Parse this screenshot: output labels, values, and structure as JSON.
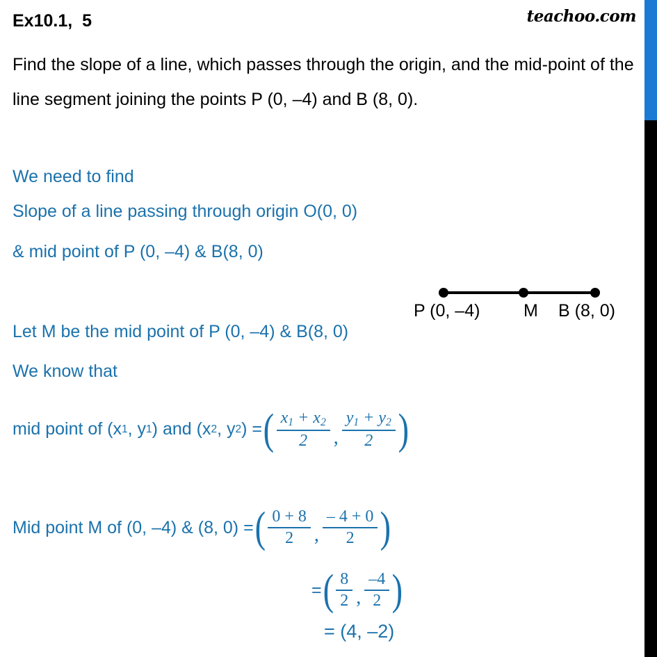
{
  "brand": {
    "name": "teachoo.com"
  },
  "header": {
    "exercise_title": "Ex10.1,  5",
    "question": "Find the slope of a line, which passes through the origin, and the mid-point of the line segment joining the points P (0, –4) and B (8, 0)."
  },
  "solution": {
    "we_need_to_find": "We need to find",
    "slope_line": "Slope of a line passing through origin O(0, 0)",
    "midpoint_line": "& mid point of P (0, –4) & B(8, 0)",
    "let_m_line": "Let M be the mid point of P (0, –4) & B(8, 0)",
    "we_know_that": "We know that",
    "formula_prefix": "mid point of (x",
    "formula_sub1": "1",
    "formula_mid1": ", y",
    "formula_sub2": "1",
    "formula_mid2": ") and (x",
    "formula_sub3": "2",
    "formula_mid3": ", y",
    "formula_sub4": "2",
    "formula_suffix": ") = ",
    "formula_frac1_num_x1": "x",
    "formula_frac1_num_x1sub": "1",
    "formula_frac1_num_plus": " + ",
    "formula_frac1_num_x2": "x",
    "formula_frac1_num_x2sub": "2",
    "formula_frac1_den": "2",
    "formula_frac2_num_y1": "y",
    "formula_frac2_num_y1sub": "1",
    "formula_frac2_num_plus": " + ",
    "formula_frac2_num_y2": "y",
    "formula_frac2_num_y2sub": "2",
    "formula_frac2_den": "2",
    "midm_prefix": "Mid point M of (0, –4) & (8, 0) = ",
    "midm_frac1_num": "0 + 8",
    "midm_frac1_den": "2",
    "midm_frac2_num": "– 4 + 0",
    "midm_frac2_den": "2",
    "eq1_prefix": "= ",
    "eq1_frac1_num": "8",
    "eq1_frac1_den": "2",
    "eq1_frac2_num": "–4",
    "eq1_frac2_den": "2",
    "eq2": "= (4, –2)",
    "comma": ",",
    "paren_open": "(",
    "paren_close": ")"
  },
  "diagram": {
    "label_p": "P (0, –4)",
    "label_m": "M",
    "label_b": "B (8, 0)"
  },
  "colors": {
    "accent_blue": "#1b72ac",
    "bar_blue": "#1b7ad4",
    "bar_black": "#000000",
    "text_black": "#000000"
  }
}
